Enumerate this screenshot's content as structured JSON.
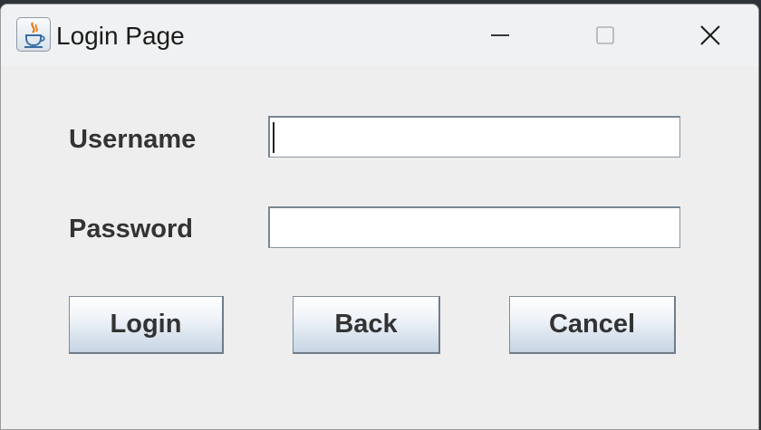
{
  "window": {
    "title": "Login Page",
    "controls": {
      "minimize_icon": "minimize-icon",
      "maximize_icon": "maximize-icon",
      "close_icon": "close-icon"
    }
  },
  "form": {
    "username_label": "Username",
    "password_label": "Password",
    "username_value": "",
    "password_value": ""
  },
  "buttons": {
    "login": "Login",
    "back": "Back",
    "cancel": "Cancel"
  },
  "colors": {
    "window_background": "#eeeeee",
    "titlebar_background": "#f0f1f2",
    "label_text": "#333333",
    "button_gradient_top": "#ffffff",
    "button_gradient_bottom": "#c7d5e3"
  }
}
